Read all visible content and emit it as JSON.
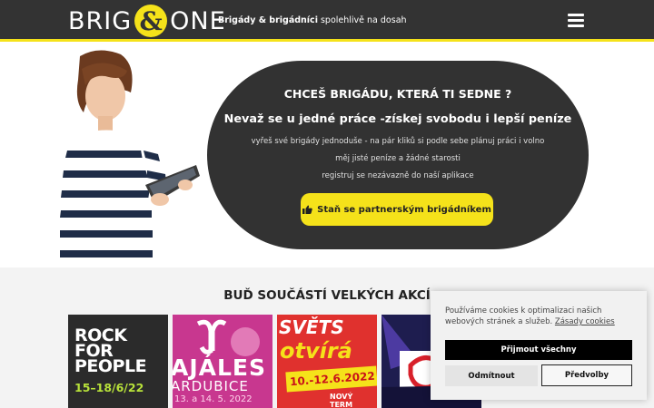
{
  "header": {
    "logo_left": "BRIG",
    "logo_amp": "&",
    "logo_right": "ONE",
    "tagline_bold": "Brigády & brigádníci",
    "tagline_rest": " spolehlivě na dosah",
    "menu_icon": "hamburger-icon"
  },
  "hero": {
    "title": "CHCEŠ BRIGÁDU, KTERÁ TI SEDNE ?",
    "subtitle": "Nevaž se u jedné práce -získej svobodu i lepší peníze",
    "lines": [
      "vyřeš své brigády jednoduše - na pár kliků si podle sebe plánuj práci i volno",
      "měj jisté peníze a žádné starosti",
      "registruj se nezávazně do naší aplikace"
    ],
    "cta_label": "Staň se partnerským brigádníkem",
    "cta_icon": "thumbs-up-icon"
  },
  "events": {
    "title": "BUĎ SOUČÁSTÍ VELKÝCH AKCÍ",
    "tiles": [
      {
        "lines": [
          "ROCK",
          "FOR",
          "PEOPLE"
        ],
        "date": "15–18/6/22"
      },
      {
        "big": "AJÁLES",
        "mid": "ARDUBICE",
        "date": "13. a 14. 5. 2022"
      },
      {
        "top": "SVĚTS",
        "mid": "otvírá",
        "date": "10.-12.6.2022",
        "bottom": "NOVÝ TERM"
      },
      {
        "text": ""
      }
    ]
  },
  "cookie": {
    "text": "Používáme cookies k optimalizaci našich webových stránek a služeb.",
    "link": "Zásady cookies",
    "accept": "Přijmout všechny",
    "deny": "Odmítnout",
    "preferences": "Předvolby"
  },
  "colors": {
    "accent": "#f5e21a",
    "dark": "#333333"
  }
}
